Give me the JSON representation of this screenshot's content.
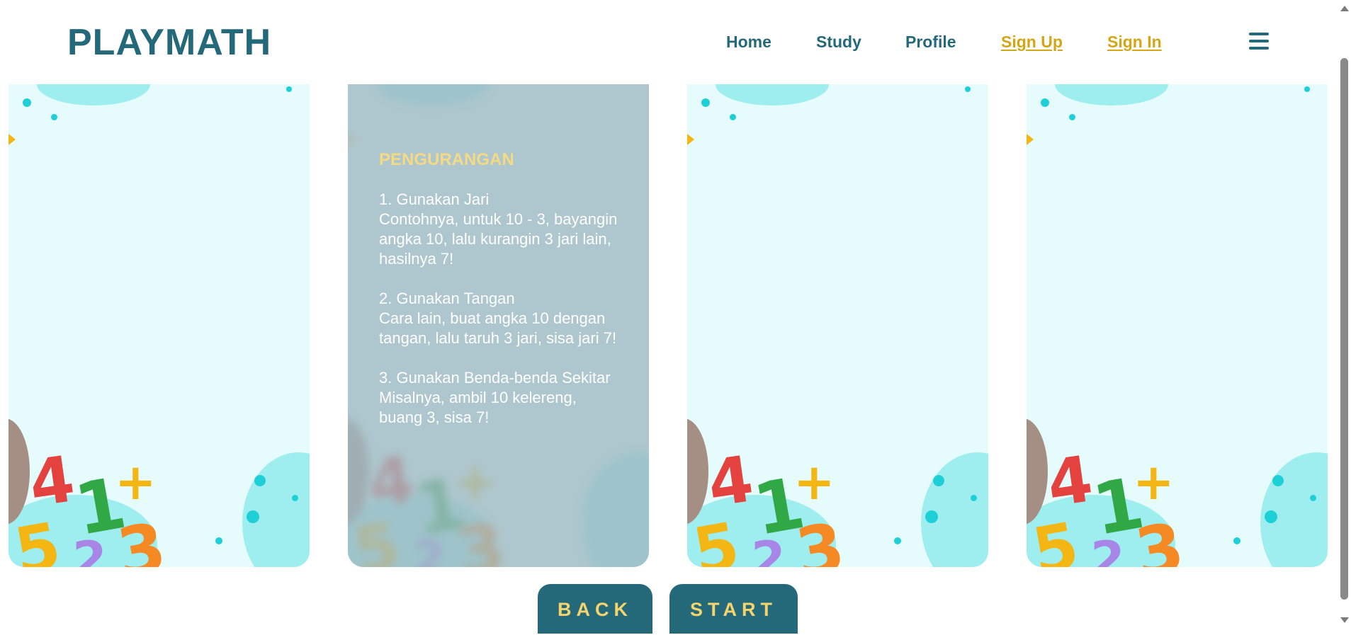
{
  "header": {
    "logo": "PLAYMATH",
    "nav": [
      {
        "label": "Home"
      },
      {
        "label": "Study"
      },
      {
        "label": "Profile"
      },
      {
        "label": "Sign Up"
      },
      {
        "label": "Sign In"
      }
    ],
    "menu_icon": "hamburger-menu-icon"
  },
  "cards": [
    {
      "active": false
    },
    {
      "active": true,
      "title": "PENGURANGAN",
      "steps": [
        {
          "heading": "1. Gunakan Jari",
          "text": "Contohnya, untuk 10 - 3, bayangin angka 10, lalu kurangin 3 jari lain, hasilnya 7!"
        },
        {
          "heading": "2. Gunakan Tangan",
          "text": "Cara lain, buat angka 10 dengan tangan, lalu taruh 3 jari, sisa jari 7!"
        },
        {
          "heading": "3. Gunakan Benda-benda Sekitar",
          "text": "Misalnya, ambil 10 kelereng, buang 3, sisa 7!"
        }
      ]
    },
    {
      "active": false
    },
    {
      "active": false
    }
  ],
  "buttons": {
    "back": "BACK",
    "start": "START"
  },
  "colors": {
    "brand": "#23697a",
    "accent": "#d4a514",
    "button_text": "#f5d36d",
    "card_bg": "#e6fbfc",
    "card_title": "#f6da83"
  }
}
